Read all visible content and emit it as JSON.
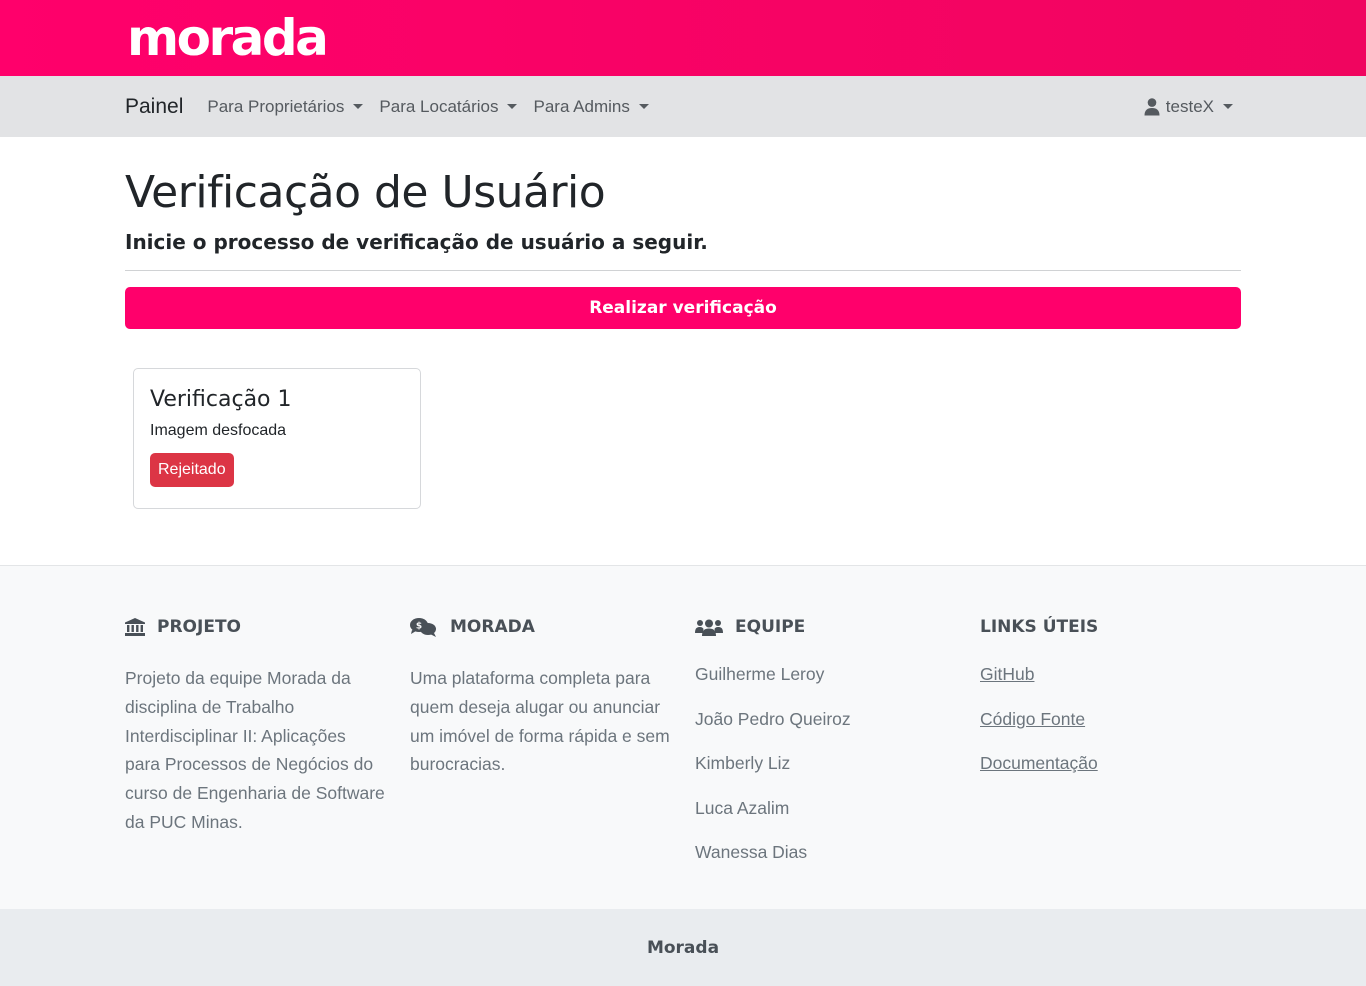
{
  "brand": {
    "logo_text": "morada",
    "color": "#ff006b"
  },
  "navbar": {
    "brand_label": "Painel",
    "menus": [
      {
        "label": "Para Proprietários"
      },
      {
        "label": "Para Locatários"
      },
      {
        "label": "Para Admins"
      }
    ],
    "user": {
      "icon": "user-icon",
      "label": "testeX"
    }
  },
  "main": {
    "title": "Verificação de Usuário",
    "subtitle": "Inicie o processo de verificação de usuário a seguir.",
    "verify_button_label": "Realizar verificação",
    "cards": [
      {
        "title": "Verificação 1",
        "reason": "Imagem desfocada",
        "status": "Rejeitado",
        "status_color": "#dc3545"
      }
    ]
  },
  "footer": {
    "project": {
      "icon": "bank-icon",
      "heading": "PROJETO",
      "text": "Projeto da equipe Morada da disciplina de Trabalho Interdisciplinar II: Aplicações para Processos de Negócios do curso de Engenharia de Software da PUC Minas."
    },
    "morada": {
      "icon": "comments-dollar-icon",
      "heading": "MORADA",
      "text": "Uma plataforma completa para quem deseja alugar ou anunciar um imóvel de forma rápida e sem burocracias."
    },
    "team": {
      "icon": "users-icon",
      "heading": "EQUIPE",
      "members": [
        "Guilherme Leroy",
        "João Pedro Queiroz",
        "Kimberly Liz",
        "Luca Azalim",
        "Wanessa Dias"
      ]
    },
    "links": {
      "heading": "LINKS ÚTEIS",
      "items": [
        "GitHub",
        "Código Fonte",
        "Documentação"
      ]
    }
  },
  "bottom_bar": {
    "text": "Morada"
  }
}
